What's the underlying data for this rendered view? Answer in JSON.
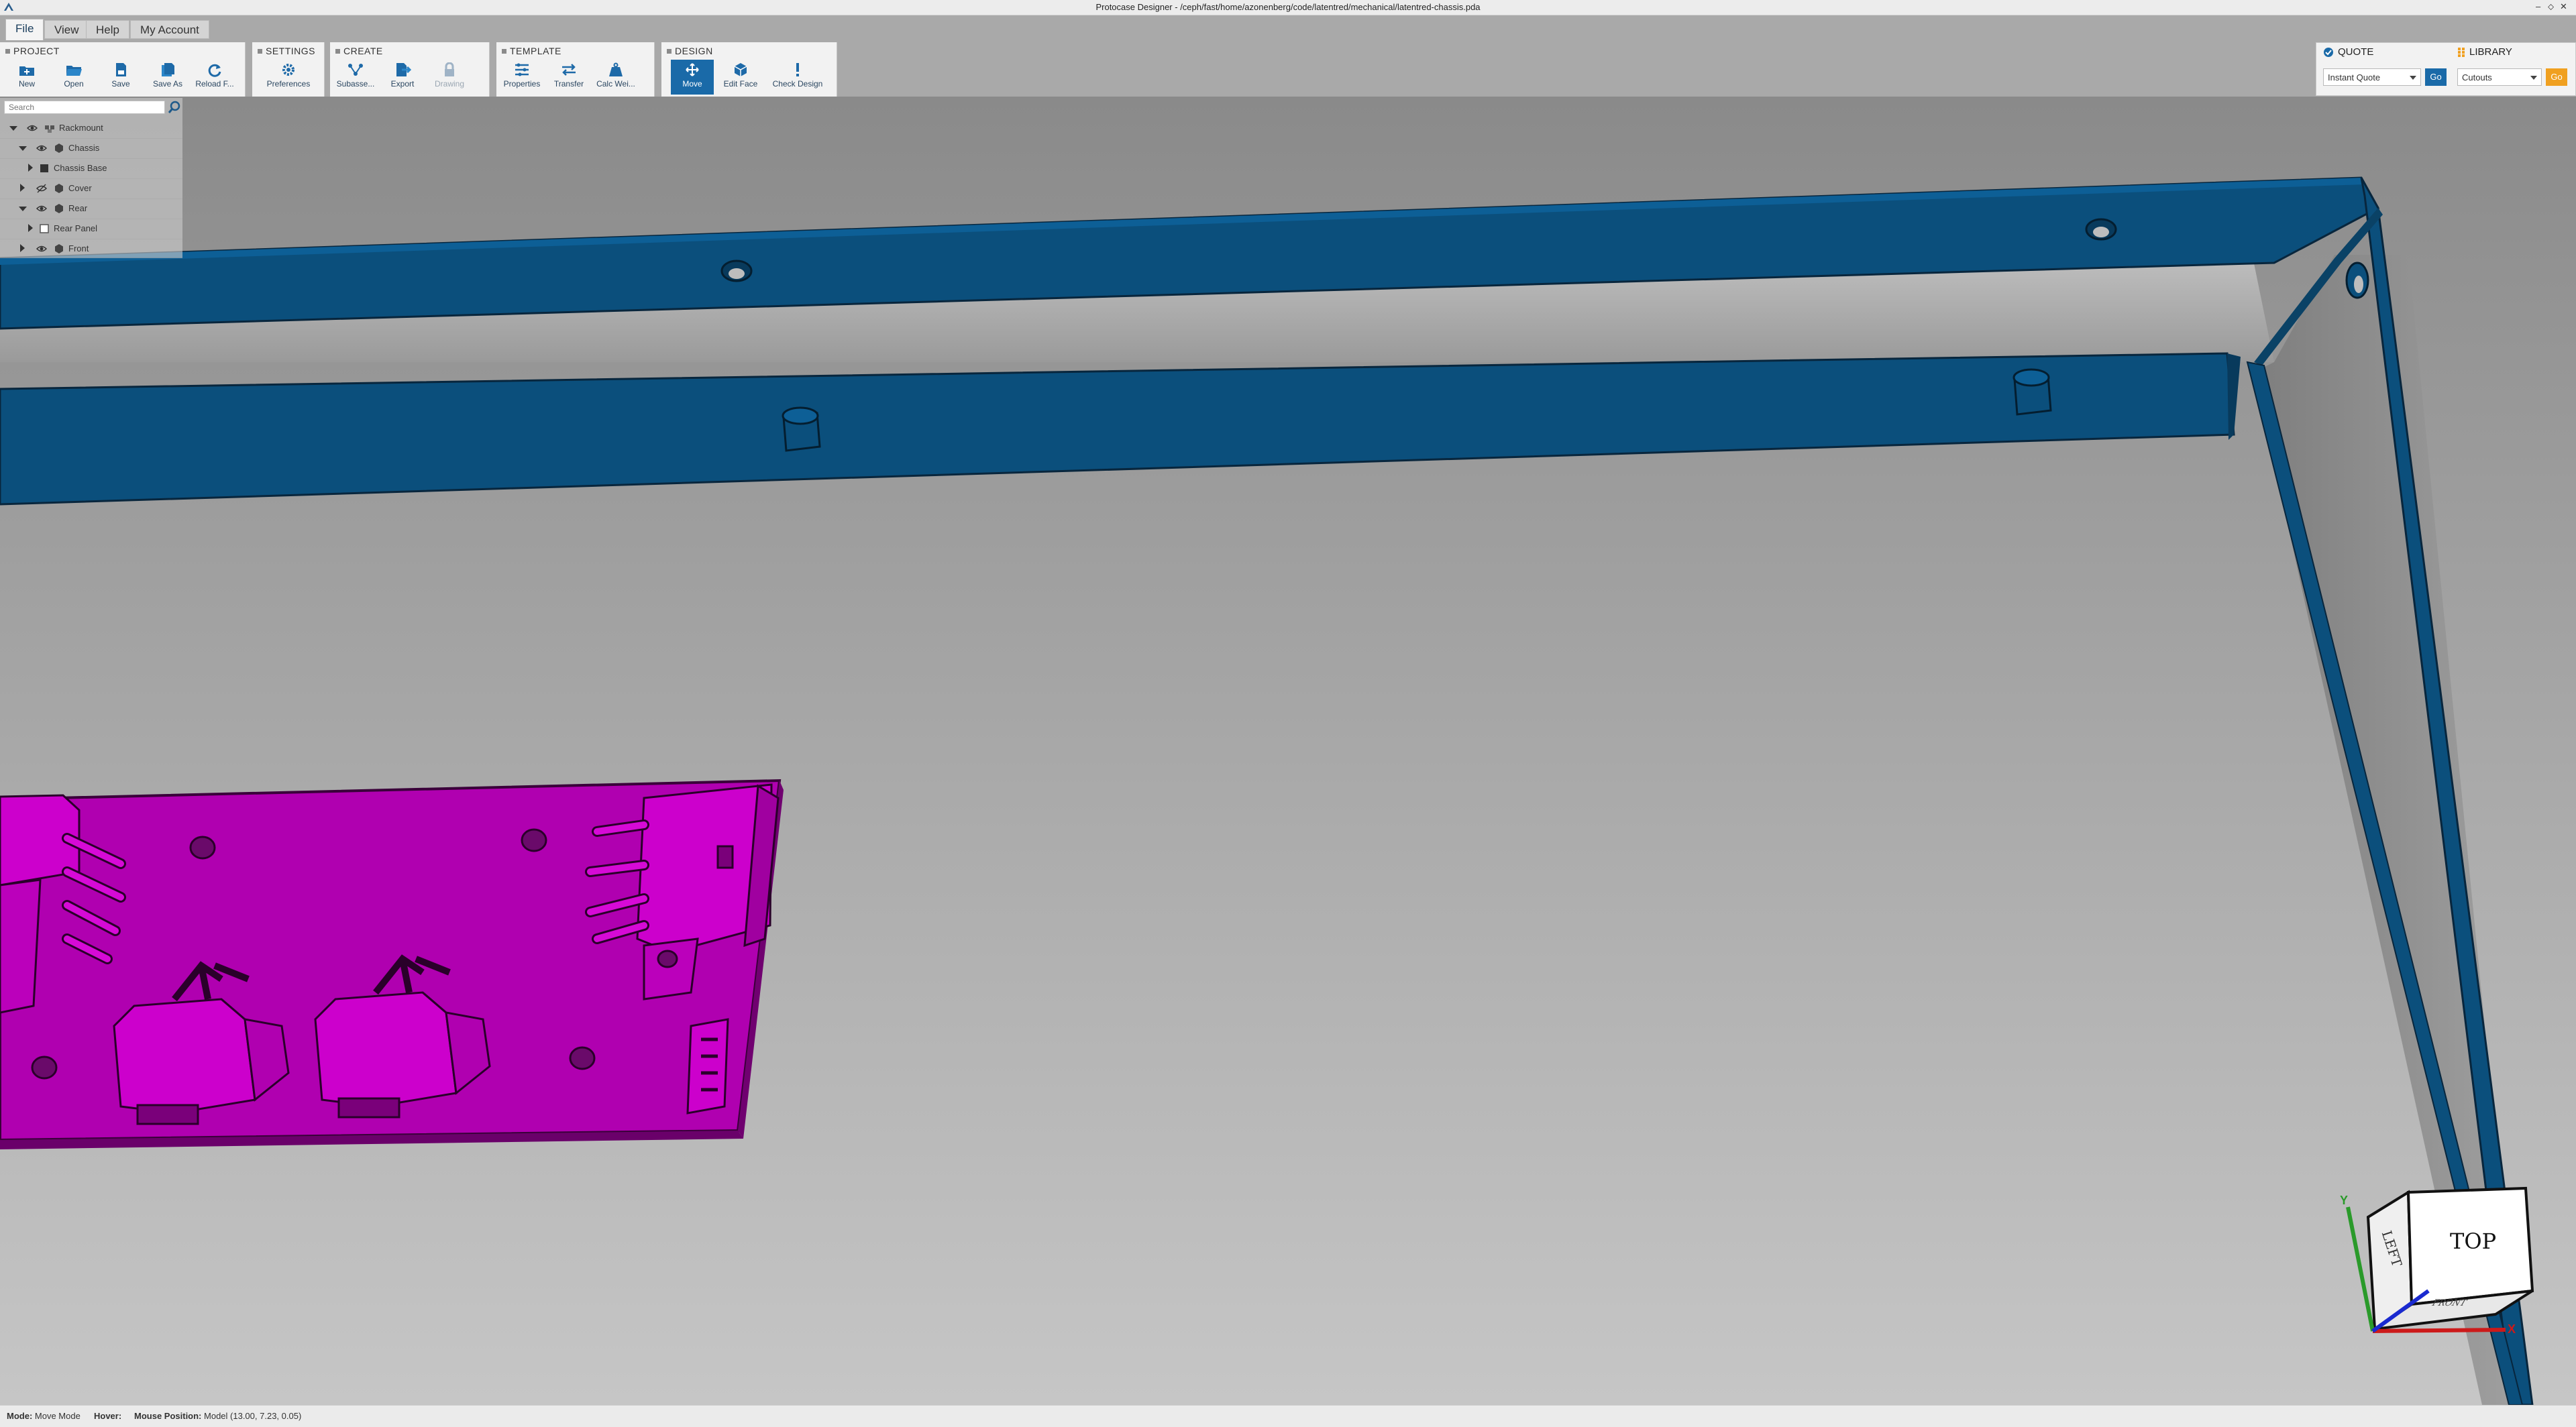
{
  "window": {
    "title": "Protocase Designer - /ceph/fast/home/azonenberg/code/latentred/mechanical/latentred-chassis.pda"
  },
  "menu": {
    "tabs": [
      {
        "label": "File",
        "active": true
      },
      {
        "label": "View"
      },
      {
        "label": "Help"
      },
      {
        "label": "My Account"
      }
    ]
  },
  "ribbon": {
    "groups": {
      "project": {
        "label": "PROJECT",
        "tools": [
          {
            "label": "New",
            "icon": "new-folder-icon"
          },
          {
            "label": "Open",
            "icon": "open-folder-icon"
          },
          {
            "label": "Save",
            "icon": "save-icon"
          },
          {
            "label": "Save As",
            "icon": "save-as-icon"
          },
          {
            "label": "Reload F...",
            "icon": "reload-icon"
          }
        ]
      },
      "settings": {
        "label": "SETTINGS",
        "tools": [
          {
            "label": "Preferences",
            "icon": "gear-icon"
          }
        ]
      },
      "create": {
        "label": "CREATE",
        "tools": [
          {
            "label": "Subasse...",
            "icon": "subassembly-icon"
          },
          {
            "label": "Export",
            "icon": "export-icon"
          },
          {
            "label": "Drawing",
            "icon": "lock-icon",
            "disabled": true
          }
        ]
      },
      "template": {
        "label": "TEMPLATE",
        "tools": [
          {
            "label": "Properties",
            "icon": "properties-icon"
          },
          {
            "label": "Transfer",
            "icon": "transfer-icon"
          },
          {
            "label": "Calc Wei...",
            "icon": "weight-icon"
          }
        ]
      },
      "design": {
        "label": "DESIGN",
        "tools": [
          {
            "label": "Move",
            "icon": "move-icon",
            "active": true
          },
          {
            "label": "Edit Face",
            "icon": "cube-icon"
          },
          {
            "label": "Check Design",
            "icon": "exclamation-icon"
          }
        ]
      }
    }
  },
  "tree": {
    "search_placeholder": "Search",
    "items": [
      {
        "label": "Rackmount",
        "level": 0,
        "expanded": true,
        "eye": true,
        "icon": "assembly-icon"
      },
      {
        "label": "Chassis",
        "level": 1,
        "expanded": true,
        "eye": true,
        "icon": "part-icon"
      },
      {
        "label": "Chassis Base",
        "level": 2,
        "expanded": false,
        "eye": false,
        "icon": "solid-icon"
      },
      {
        "label": "Cover",
        "level": 1,
        "expanded": false,
        "eye": true,
        "icon": "part-icon"
      },
      {
        "label": "Rear",
        "level": 1,
        "expanded": true,
        "eye": true,
        "icon": "part-icon"
      },
      {
        "label": "Rear Panel",
        "level": 2,
        "expanded": false,
        "eye": false,
        "icon": "panel-icon"
      },
      {
        "label": "Front",
        "level": 1,
        "expanded": false,
        "eye": true,
        "icon": "part-icon"
      }
    ]
  },
  "quote": {
    "quote_label": "QUOTE",
    "library_label": "LIBRARY",
    "quote_select": "Instant Quote",
    "library_select": "Cutouts",
    "go_label": "Go",
    "go2_label": "Go",
    "colors": {
      "go_blue": "#1a6aa8",
      "go_orange": "#f0a020"
    }
  },
  "viewcube": {
    "top": "TOP",
    "left": "LEFT",
    "front": "FRONT",
    "axis_x": "X",
    "axis_y": "Y"
  },
  "status": {
    "mode_label": "Mode:",
    "mode_value": "Move Mode",
    "hover_label": "Hover:",
    "hover_value": "",
    "mouse_label": "Mouse Position:",
    "mouse_value": "Model (13.00, 7.23, 0.05)"
  },
  "colors": {
    "chassis_blue": "#0b4f7c",
    "pcb_magenta": "#cc00cc",
    "background_top": "#8c8c8c",
    "background_bottom": "#c4c4c4",
    "accent": "#1a6aa8"
  }
}
